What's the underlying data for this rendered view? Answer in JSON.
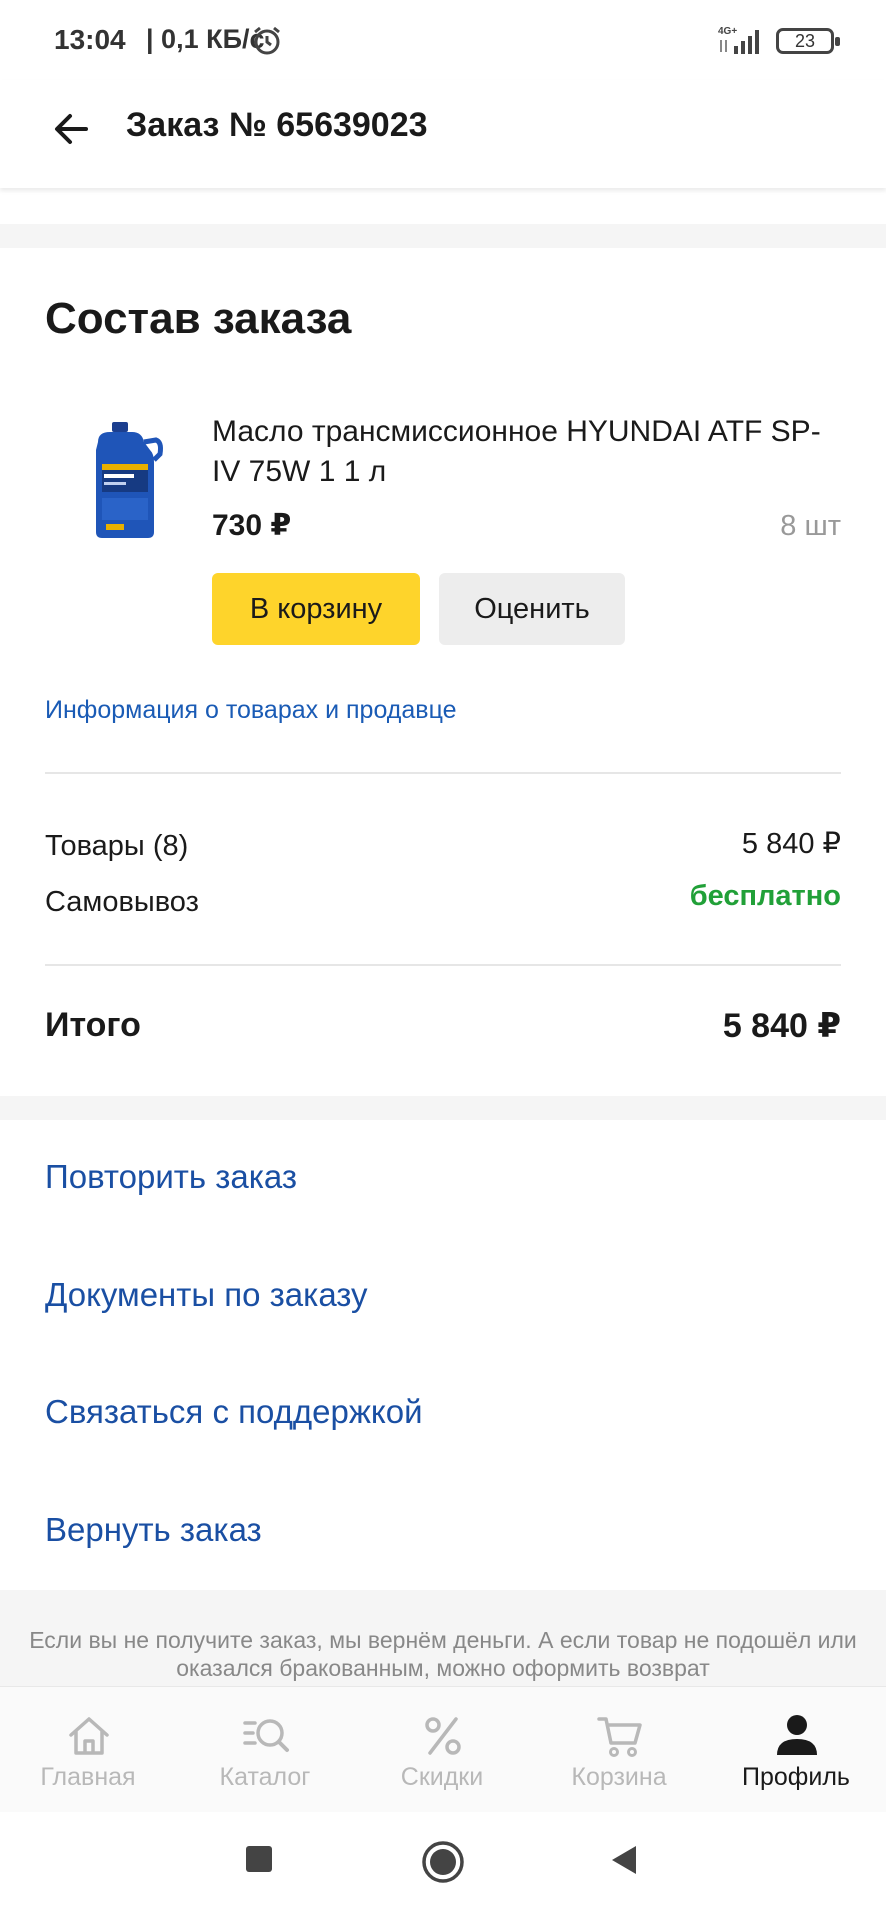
{
  "status_bar": {
    "time": "13:04",
    "network_speed": "| 0,1 КБ/с",
    "signal_type": "4G+",
    "battery_level": "23"
  },
  "header": {
    "title": "Заказ № 65639023"
  },
  "order": {
    "section_title": "Состав заказа",
    "product": {
      "name": "Масло трансмиссионное HYUNDAI ATF SP-IV 75W 1 1 л",
      "price": "730 ₽",
      "quantity": "8 шт",
      "image_icon": "atf-oil-bottle"
    },
    "buttons": {
      "add_to_cart": "В корзину",
      "rate": "Оценить"
    },
    "info_link": "Информация о товарах и продавце",
    "summary": {
      "goods_label": "Товары (8)",
      "goods_value": "5 840 ₽",
      "delivery_label": "Самовывоз",
      "delivery_value": "бесплатно",
      "total_label": "Итого",
      "total_value": "5 840 ₽"
    }
  },
  "actions": [
    "Повторить заказ",
    "Документы по заказу",
    "Связаться с поддержкой",
    "Вернуть заказ"
  ],
  "footer_note": "Если вы не получите заказ, мы вернём деньги. А если товар не подошёл или оказался бракованным, можно оформить возврат",
  "bottom_nav": {
    "items": [
      {
        "label": "Главная",
        "icon": "home-icon"
      },
      {
        "label": "Каталог",
        "icon": "catalog-search-icon"
      },
      {
        "label": "Скидки",
        "icon": "percent-icon"
      },
      {
        "label": "Корзина",
        "icon": "cart-icon"
      },
      {
        "label": "Профиль",
        "icon": "profile-icon"
      }
    ],
    "active": "Профиль"
  },
  "colors": {
    "accent_yellow": "#fed42b",
    "link_blue": "#1a4fa3",
    "free_green": "#21a038"
  }
}
